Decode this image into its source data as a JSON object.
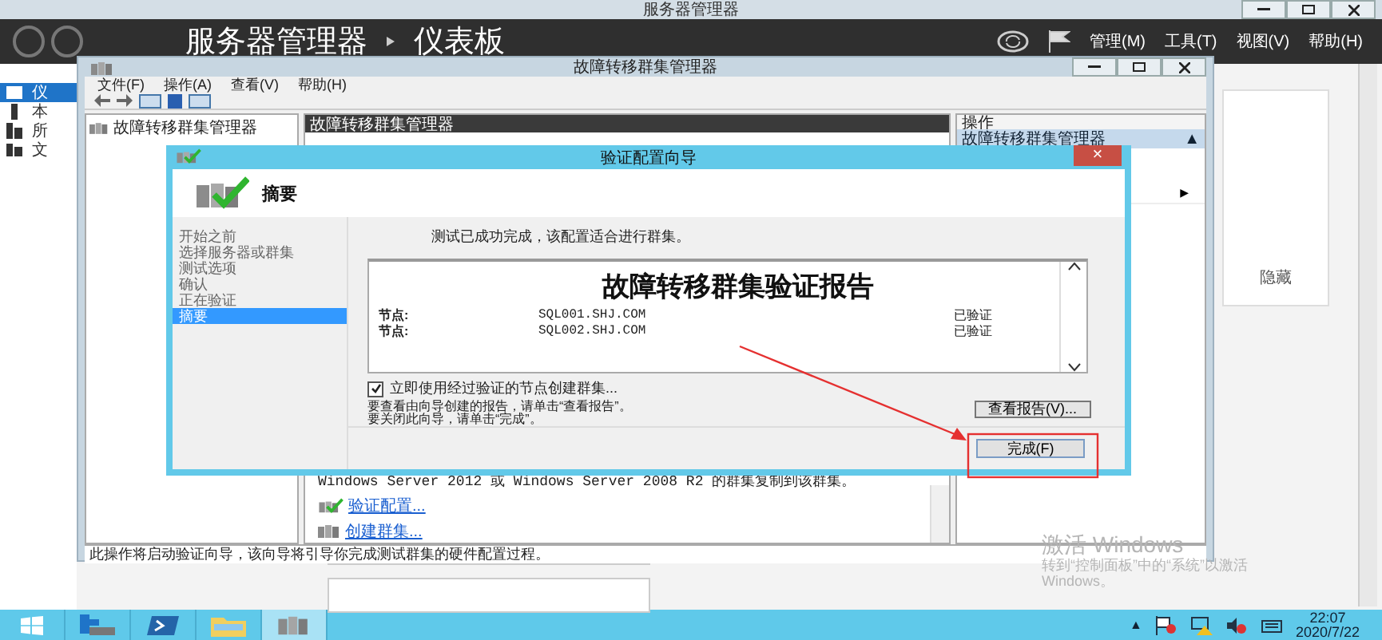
{
  "server_manager": {
    "title": "服务器管理器",
    "breadcrumb": [
      "服务器管理器",
      "仪表板"
    ],
    "menus": [
      "管理(M)",
      "工具(T)",
      "视图(V)",
      "帮助(H)"
    ],
    "nav": [
      {
        "label": "仪",
        "kind": "dashboard",
        "selected": true
      },
      {
        "label": "本",
        "kind": "server",
        "selected": false
      },
      {
        "label": "所",
        "kind": "servers",
        "selected": false
      },
      {
        "label": "文",
        "kind": "files",
        "selected": false
      }
    ],
    "hide_label": "隐藏"
  },
  "cluster_manager": {
    "title": "故障转移群集管理器",
    "menus": [
      "文件(F)",
      "操作(A)",
      "查看(V)",
      "帮助(H)"
    ],
    "tree": [
      "故障转移群集管理器"
    ],
    "center_header": "故障转移群集管理器",
    "center_line": "Windows Server 2012 或 Windows Server 2008 R2 的群集复制到该群集。",
    "links": [
      {
        "label": "验证配置...",
        "kind": "validate"
      },
      {
        "label": "创建群集...",
        "kind": "create"
      }
    ],
    "actions_header": "操作",
    "actions_group": "故障转移群集管理器",
    "collapse_glyph": "▲",
    "submenu_glyph": "▶",
    "status": "此操作将启动验证向导，该向导将引导你完成测试群集的硬件配置过程。"
  },
  "wizard": {
    "title": "验证配置向导",
    "close_glyph": "×",
    "heading": "摘要",
    "steps": [
      {
        "label": "开始之前",
        "selected": false
      },
      {
        "label": "选择服务器或群集",
        "selected": false
      },
      {
        "label": "测试选项",
        "selected": false
      },
      {
        "label": "确认",
        "selected": false
      },
      {
        "label": "正在验证",
        "selected": false
      },
      {
        "label": "摘要",
        "selected": true
      }
    ],
    "message": "测试已成功完成，该配置适合进行群集。",
    "report": {
      "title": "故障转移群集验证报告",
      "nodes": [
        {
          "label": "节点:",
          "name": "SQL001.SHJ.COM",
          "status": "已验证"
        },
        {
          "label": "节点:",
          "name": "SQL002.SHJ.COM",
          "status": "已验证"
        }
      ]
    },
    "create_cluster": {
      "label": "立即使用经过验证的节点创建群集...",
      "checked": true
    },
    "instructions": [
      "要查看由向导创建的报告，请单击“查看报告”。",
      "要关闭此向导，请单击“完成”。"
    ],
    "view_report_button": "查看报告(V)...",
    "finish_button": "完成(F)"
  },
  "activation": {
    "title": "激活 Windows",
    "lines": [
      "转到“控制面板”中的“系统”以激活",
      "Windows。"
    ]
  },
  "taskbar": {
    "apps": [
      {
        "kind": "start",
        "selected": false
      },
      {
        "kind": "server",
        "selected": false
      },
      {
        "kind": "powershell",
        "selected": false
      },
      {
        "kind": "explorer",
        "selected": false
      },
      {
        "kind": "cluster",
        "selected": true
      }
    ],
    "tray_glyph": "▲",
    "time": "22:07",
    "date": "2020/7/22"
  }
}
